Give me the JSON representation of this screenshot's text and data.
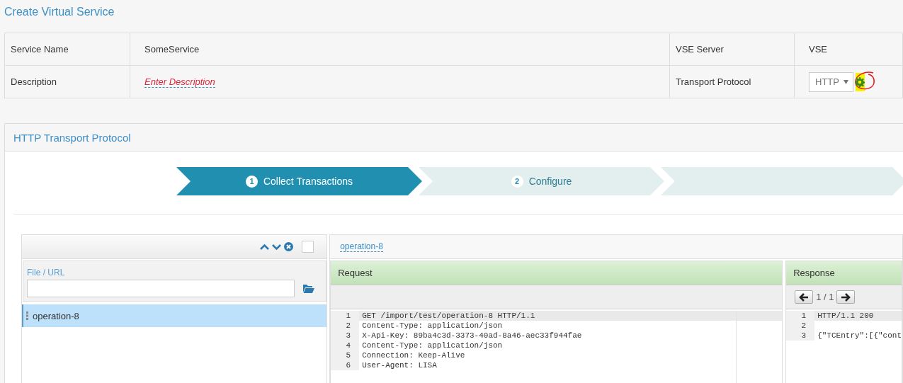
{
  "title": "Create Virtual Service",
  "fields": [
    {
      "label": "Service Name",
      "value": "SomeService",
      "kind": "text"
    },
    {
      "label": "VSE Server",
      "value": "VSE",
      "kind": "text"
    },
    {
      "label": "Description",
      "value": "Enter Description",
      "kind": "editable"
    },
    {
      "label": "Transport Protocol",
      "value": "HTTP",
      "kind": "select"
    }
  ],
  "protocol_panel": {
    "title": "HTTP Transport Protocol",
    "steps": [
      {
        "number": "1",
        "label": "Collect Transactions",
        "selected": true
      },
      {
        "number": "2",
        "label": "Configure",
        "selected": false
      }
    ]
  },
  "transactions": {
    "select_all_checked": false,
    "file_label": "File / URL",
    "items": [
      {
        "label": "operation-8",
        "selected": true
      }
    ]
  },
  "detail": {
    "link": "operation-8",
    "request": {
      "title": "Request",
      "lines": [
        {
          "n": "1",
          "text": "GET /import/test/operation-8 HTTP/1.1"
        },
        {
          "n": "2",
          "text": "Content-Type: application/json"
        },
        {
          "n": "3",
          "text": "X-Api-Key: 89ba4c3d-3373-40ad-8a46-aec33f944fae"
        },
        {
          "n": "4",
          "text": "Content-Type: application/json"
        },
        {
          "n": "5",
          "text": "Connection: Keep-Alive"
        },
        {
          "n": "6",
          "text": "User-Agent: LISA"
        }
      ]
    },
    "response": {
      "title": "Response",
      "pager": "1 / 1",
      "lines": [
        {
          "n": "1",
          "text": "HTTP/1.1 200"
        },
        {
          "n": "2"
        },
        {
          "n": "3",
          "text": "{\"TCEntry\":[{\"cont"
        }
      ]
    }
  }
}
